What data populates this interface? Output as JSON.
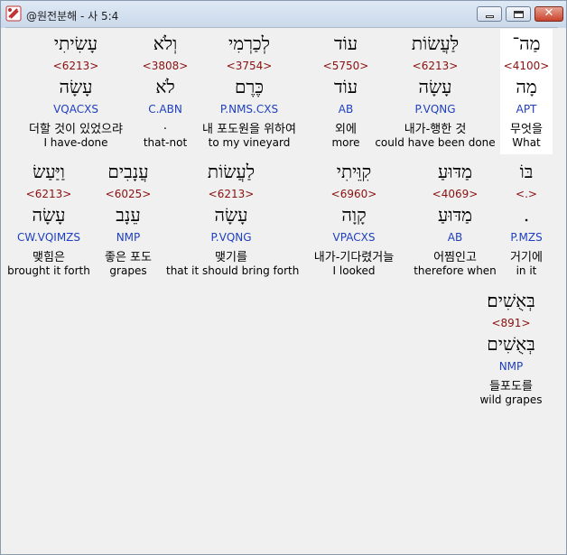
{
  "window": {
    "title": "@원전분해 - 사 5:4",
    "close_glyph": "✕"
  },
  "words": [
    {
      "heb": "מַה־",
      "strong": "<4100>",
      "lemma": "מָה",
      "parse": "APT",
      "kor": "무엇을",
      "eng": "What",
      "selected": true
    },
    {
      "heb": "לַּעֲשׂוֹת",
      "strong": "<6213>",
      "lemma": "עָשָׂה",
      "parse": "P.VQNG",
      "kor": "내가-행한 것",
      "eng": "could have been done"
    },
    {
      "heb": "עוֹד",
      "strong": "<5750>",
      "lemma": "עוֹד",
      "parse": "AB",
      "kor": "외에",
      "eng": "more"
    },
    {
      "heb": "לְכַרְמִי",
      "strong": "<3754>",
      "lemma": "כֶּרֶם",
      "parse": "P.NMS.CXS",
      "kor": "내 포도원을 위하여",
      "eng": "to my vineyard"
    },
    {
      "heb": "וְלֹא",
      "strong": "<3808>",
      "lemma": "לֹא",
      "parse": "C.ABN",
      "kor": ".",
      "eng": "that-not"
    },
    {
      "heb": "עָשִׂיתִי",
      "strong": "<6213>",
      "lemma": "עָשָׂה",
      "parse": "VQACXS",
      "kor": "더할 것이 있었으랴",
      "eng": "I have-done"
    },
    {
      "heb": "בּוֹ",
      "strong": "<.>",
      "lemma": ".",
      "parse": "P.MZS",
      "kor": "거기에",
      "eng": "in it"
    },
    {
      "heb": "מַדּוּעַ",
      "strong": "<4069>",
      "lemma": "מַדּוּעַ",
      "parse": "AB",
      "kor": "어찜인고",
      "eng": "therefore when"
    },
    {
      "heb": "קִוֵּיתִי",
      "strong": "<6960>",
      "lemma": "קָוָה",
      "parse": "VPACXS",
      "kor": "내가-기다렸거늘",
      "eng": "I looked"
    },
    {
      "heb": "לַעֲשׂוֹת",
      "strong": "<6213>",
      "lemma": "עָשָׂה",
      "parse": "P.VQNG",
      "kor": "맺기를",
      "eng": "that it should bring forth"
    },
    {
      "heb": "עֲנָבִים",
      "strong": "<6025>",
      "lemma": "עֵנָב",
      "parse": "NMP",
      "kor": "좋은 포도",
      "eng": "grapes"
    },
    {
      "heb": "וַיַּעַשׂ",
      "strong": "<6213>",
      "lemma": "עָשָׂה",
      "parse": "CW.VQIMZS",
      "kor": "맺힘은",
      "eng": "brought it forth"
    },
    {
      "heb": "בְּאֻשִׁים׃",
      "strong": "<891>",
      "lemma": "בְּאֻשִׁים",
      "parse": "NMP",
      "kor": "들포도를",
      "eng": "wild grapes"
    }
  ]
}
